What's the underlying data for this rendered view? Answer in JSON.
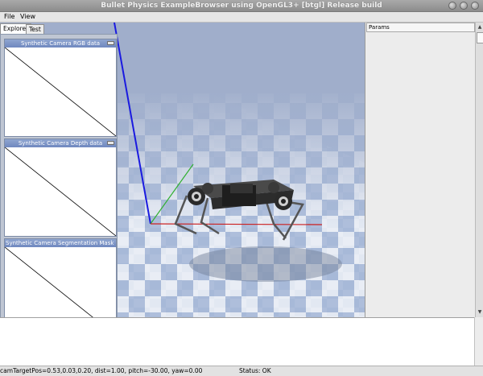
{
  "window": {
    "title": "Bullet Physics ExampleBrowser using OpenGL3+ [btgl] Release build"
  },
  "menu": {
    "file": "File",
    "view": "View"
  },
  "explorer": {
    "tabs": [
      {
        "label": "Explorer",
        "active": true
      },
      {
        "label": "Test",
        "active": false
      }
    ]
  },
  "cameras": [
    {
      "title": "Synthetic Camera RGB data"
    },
    {
      "title": "Synthetic Camera Depth data"
    },
    {
      "title": "Synthetic Camera Segmentation Mask"
    }
  ],
  "params": {
    "tab": "Params"
  },
  "status": {
    "camera": "camTargetPos=0.53,0.03,0.20, dist=1.00, pitch=-30.00, yaw=0.00",
    "state": "Status: OK"
  },
  "colors": {
    "sky": "#a0aecb",
    "floor_light": "#e9edf5",
    "floor_dark": "#a7b9d8",
    "axis_x": "#cc2020",
    "axis_y": "#30b030",
    "axis_z": "#1a1ae0",
    "panel_title": "#7b93c6"
  }
}
